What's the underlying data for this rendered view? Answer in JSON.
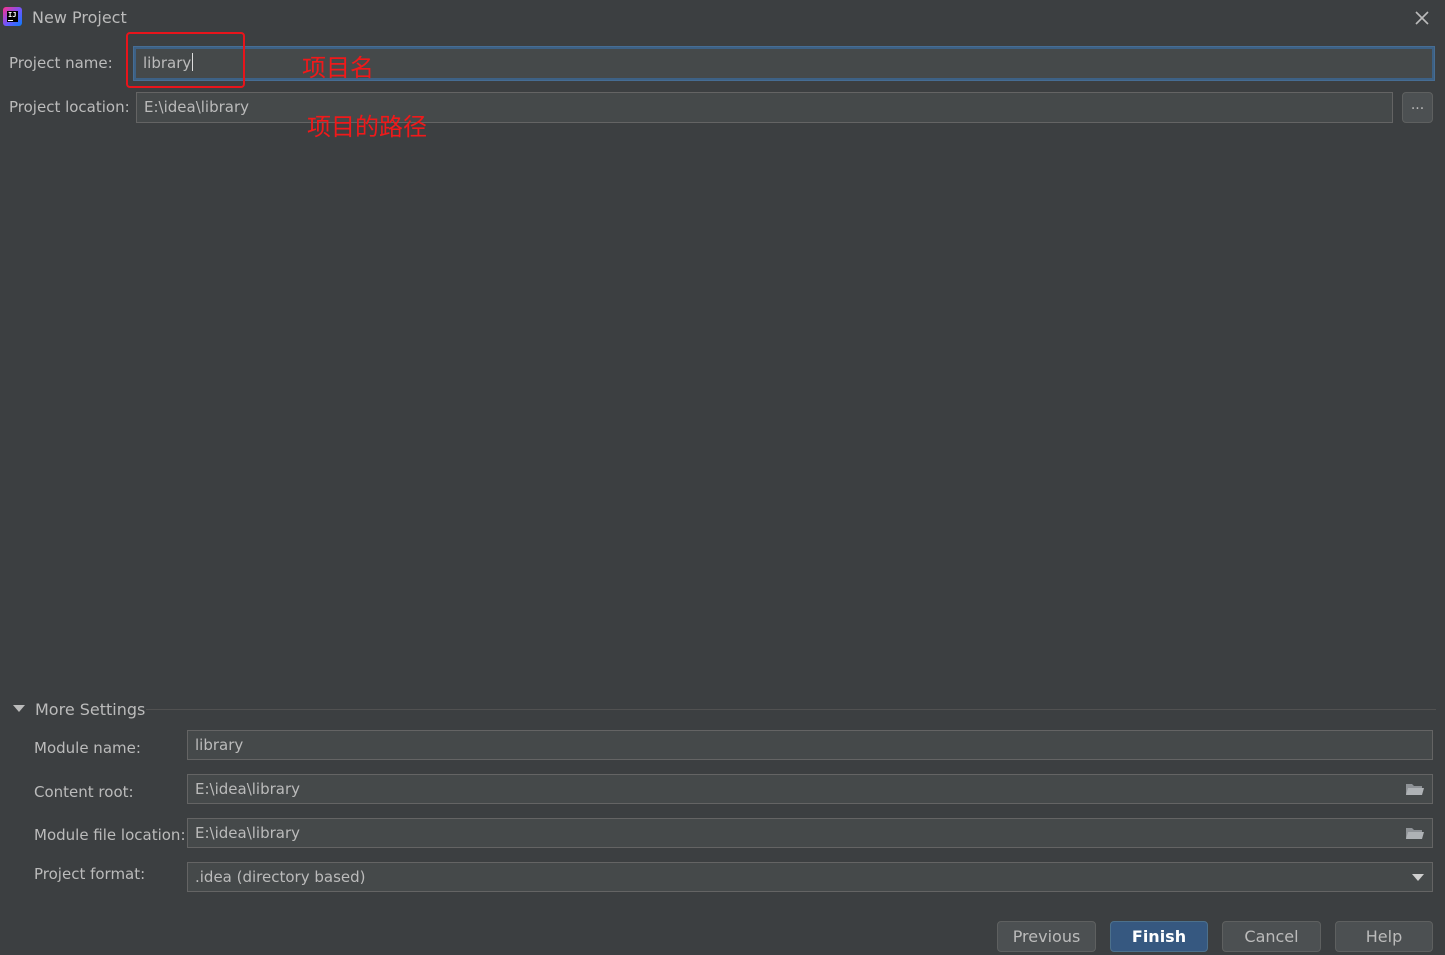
{
  "window": {
    "title": "New Project",
    "close_icon": "close-icon"
  },
  "project": {
    "name_label": "Project name:",
    "name_value": "library",
    "location_label": "Project location:",
    "location_value": "E:\\idea\\library",
    "browse_label": "..."
  },
  "annotations": {
    "name_note": "项目名",
    "location_note": "项目的路径",
    "highlight_color": "#e8141b"
  },
  "more_settings": {
    "toggle_label": "More Settings",
    "expanded": true,
    "module_name_label": "Module name:",
    "module_name_value": "library",
    "content_root_label": "Content root:",
    "content_root_value": "E:\\idea\\library",
    "module_file_label": "Module file location:",
    "module_file_value": "E:\\idea\\library",
    "format_label": "Project format:",
    "format_value": ".idea (directory based)"
  },
  "buttons": {
    "previous": "Previous",
    "finish": "Finish",
    "cancel": "Cancel",
    "help": "Help"
  },
  "colors": {
    "background": "#3c3f41",
    "field": "#45494a",
    "focus_border": "#3d6185",
    "primary_button": "#365880"
  }
}
